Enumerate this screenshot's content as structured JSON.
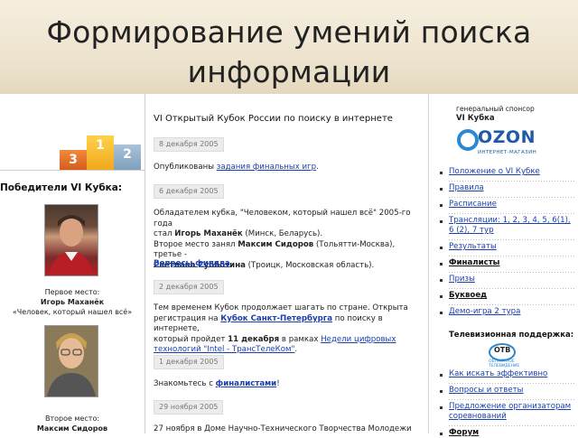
{
  "slide": {
    "title_line1": "Формирование умений поиска",
    "title_line2": "информации"
  },
  "left": {
    "podium": {
      "first": "1",
      "second": "2",
      "third": "3"
    },
    "winners_title": "Победители VI Кубка:",
    "winner1": {
      "place": "Первое место:",
      "name": "Игорь Маханёк",
      "nick": "«Человек, который нашел всё»"
    },
    "winner2": {
      "place": "Второе место:",
      "name": "Максим Сидоров"
    }
  },
  "center": {
    "title": "VI Открытый Кубок России по поиску в интернете",
    "news": [
      {
        "date": "8 декабря 2005",
        "text_pre": "Опубликованы ",
        "link": "задания финальных игр",
        "text_post": "."
      },
      {
        "date": "6 декабря 2005",
        "l1": "Обладателем кубка, \"Человеком, который нашел всё\" 2005-го года",
        "l2_pre": "стал ",
        "l2_bold": "Игорь Маханёк",
        "l2_post": " (Минск, Беларусь).",
        "l3_pre": "Второе место занял ",
        "l3_bold": "Максим Сидоров",
        "l3_post": " (Тольятти-Москва), третье -",
        "l4_bold": "Светлана Субботина",
        "l4_post": " (Троицк, Московская область).",
        "link": "Вопросы финала",
        "link_post": "."
      },
      {
        "date": "2 декабря 2005",
        "l1": "Тем временем Кубок продолжает шагать по стране. Открыта",
        "l2_pre": "регистрация на ",
        "l2_link": "Кубок Санкт-Петербурга",
        "l2_post": " по поиску в интернете,",
        "l3_pre": "который пройдет ",
        "l3_bold": "11 декабря",
        "l3_mid": " в рамках ",
        "l3_link": "Недели цифровых",
        "l4_link": "технологий \"Intel - ТрансТелеКом\"",
        "l4_post": "."
      },
      {
        "date": "1 декабря 2005",
        "text_pre": "Знакомьтесь с ",
        "link": "финалистами",
        "text_post": "!"
      },
      {
        "date": "29 ноября 2005",
        "text": "27 ноября в Доме Научно-Технического Творчества Молодежи"
      }
    ]
  },
  "right": {
    "sponsor_caption": "генеральный спонсор",
    "sponsor_event": "VI Кубка",
    "ozon": {
      "word": "OZON",
      "tagline": "ИНТЕРНЕТ-МАГАЗИН"
    },
    "nav": [
      "Положение о VI Кубке",
      "Правила",
      "Расписание",
      "Трансляции: 1, 2, 3, 4, 5, 6(1), 6 (2), 7 тур",
      "Результаты",
      "Финалисты",
      "Призы",
      "Буквоед",
      "Демо-игра 2 тура"
    ],
    "tv_title": "Телевизионная поддержка:",
    "tv_logo": {
      "text": "ОТВ",
      "sub": "ОБЛАСТНОЕ ТЕЛЕВИДЕНИЕ"
    },
    "nav2": [
      "Как искать эффективно",
      "Вопросы и ответы",
      "Предложение организаторам соревнований",
      "Форум"
    ]
  }
}
